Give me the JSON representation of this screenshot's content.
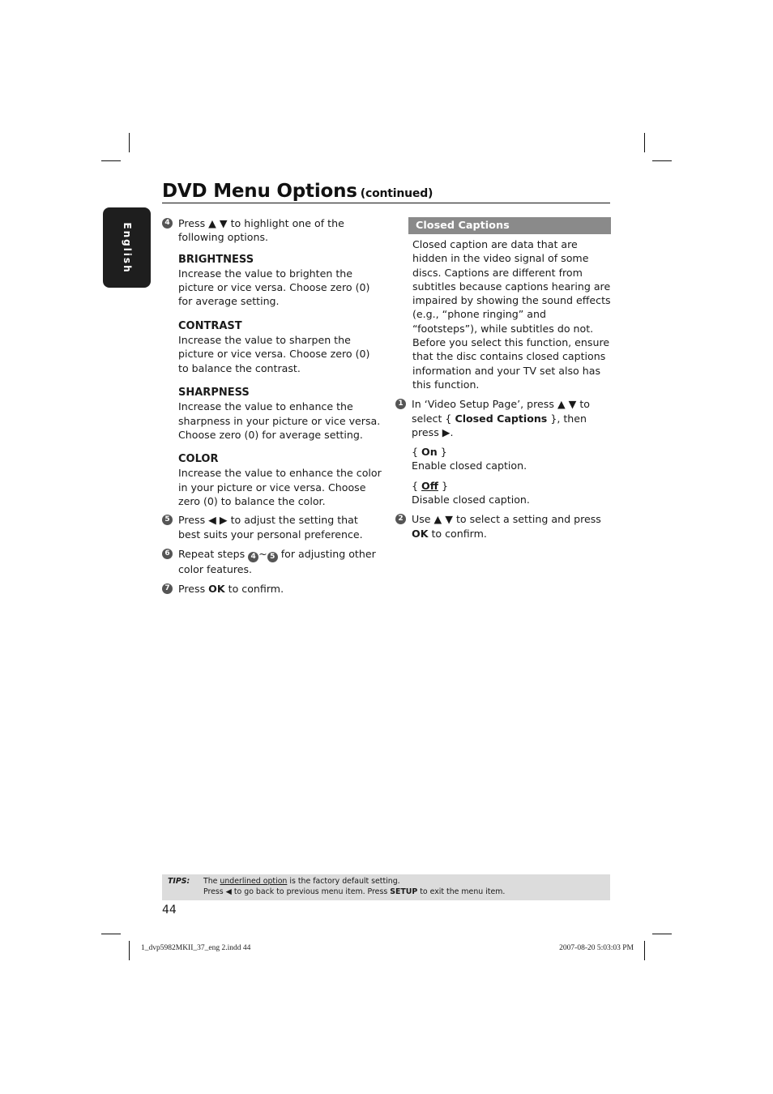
{
  "header": {
    "title": "DVD Menu Options",
    "continued": "(continued)"
  },
  "language_tab": "English",
  "left_column": {
    "step4": {
      "number": "4",
      "text_before": "Press",
      "arrows": "▲ ▼",
      "text_after": "to highlight one of the following options."
    },
    "options": [
      {
        "heading": "BRIGHTNESS",
        "text": "Increase the value to brighten the picture or vice versa. Choose zero (0) for average setting."
      },
      {
        "heading": "CONTRAST",
        "text": "Increase the value to sharpen the picture or vice versa.  Choose zero (0) to balance the contrast."
      },
      {
        "heading": "SHARPNESS",
        "text": "Increase the value to enhance the sharpness in your picture or vice versa. Choose zero (0) for average setting."
      },
      {
        "heading": "COLOR",
        "text": "Increase the value to enhance the color in your picture or vice versa. Choose zero (0) to balance the color."
      }
    ],
    "step5": {
      "number": "5",
      "text_before": "Press",
      "arrows": "◀ ▶",
      "text_after": "to adjust the setting that best suits your personal preference."
    },
    "step6": {
      "number": "6",
      "text_before": "Repeat steps",
      "from": "4",
      "tilde": "~",
      "to": "5",
      "text_after": "for adjusting other color features."
    },
    "step7": {
      "number": "7",
      "text_before": "Press",
      "bold": "OK",
      "text_after": "to confirm."
    }
  },
  "right_column": {
    "section_title": "Closed Captions",
    "description": "Closed caption are data that are hidden in the video signal of some discs. Captions are different from subtitles because captions hearing are impaired by showing the sound effects (e.g., “phone ringing” and “footsteps”), while subtitles do not. Before you select this function, ensure that the disc contains closed captions information and your TV set also has this function.",
    "step1": {
      "number": "1",
      "text_before": "In ‘Video Setup Page’, press",
      "arrows": "▲ ▼",
      "text_mid": "to select {",
      "bold": "Closed Captions",
      "text_after": "}, then press",
      "arrow_right": "▶",
      "period": "."
    },
    "settings": [
      {
        "open": "{",
        "value": "On",
        "close": "}",
        "underlined": false,
        "desc": "Enable closed caption."
      },
      {
        "open": "{",
        "value": "Off",
        "close": "}",
        "underlined": true,
        "desc": "Disable closed caption."
      }
    ],
    "step2": {
      "number": "2",
      "text_before": "Use",
      "arrows": "▲ ▼",
      "text_after": "to select a setting and press",
      "bold": "OK",
      "text_end": "to confirm."
    }
  },
  "tips": {
    "label": "TIPS:",
    "line1_before": "The",
    "line1_underlined": "underlined option",
    "line1_after": "is the factory default setting.",
    "line2_before": "Press",
    "line2_arrow": "◀",
    "line2_mid": "to go back to previous menu item. Press",
    "line2_bold": "SETUP",
    "line2_after": "to exit the menu item."
  },
  "page_number": "44",
  "slug": {
    "file": "1_dvp5982MKII_37_eng 2.indd   44",
    "timestamp": "2007-08-20   5:03:03 PM"
  }
}
